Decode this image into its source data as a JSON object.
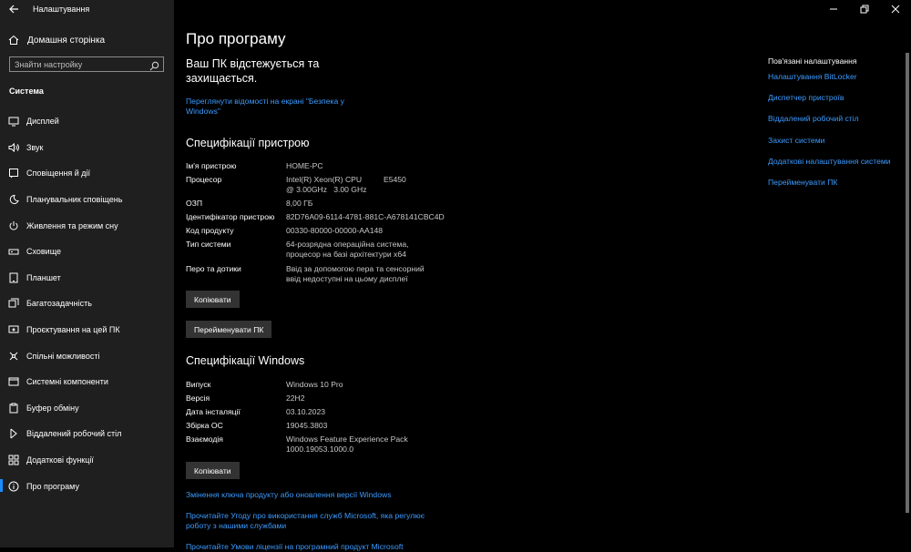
{
  "window": {
    "title": "Налаштування",
    "controls": [
      "minimize",
      "restore",
      "close"
    ]
  },
  "sidebar": {
    "home_label": "Домашня сторінка",
    "search_placeholder": "Знайти настройку",
    "section_title": "Система",
    "items": [
      {
        "label": "Дисплей",
        "icon": "display-icon"
      },
      {
        "label": "Звук",
        "icon": "sound-icon"
      },
      {
        "label": "Сповіщення й дії",
        "icon": "notifications-icon"
      },
      {
        "label": "Планувальник сповіщень",
        "icon": "focus-assist-icon"
      },
      {
        "label": "Живлення та режим сну",
        "icon": "power-icon"
      },
      {
        "label": "Сховище",
        "icon": "storage-icon"
      },
      {
        "label": "Планшет",
        "icon": "tablet-icon"
      },
      {
        "label": "Багатозадачність",
        "icon": "multitasking-icon"
      },
      {
        "label": "Проєктування на цей ПК",
        "icon": "projecting-icon"
      },
      {
        "label": "Спільні можливості",
        "icon": "shared-experiences-icon"
      },
      {
        "label": "Системні компоненти",
        "icon": "system-components-icon"
      },
      {
        "label": "Буфер обміну",
        "icon": "clipboard-icon"
      },
      {
        "label": "Віддалений робочий стіл",
        "icon": "remote-desktop-icon"
      },
      {
        "label": "Додаткові функції",
        "icon": "optional-features-icon"
      },
      {
        "label": "Про програму",
        "icon": "about-icon",
        "selected": true
      }
    ]
  },
  "main": {
    "title": "Про програму",
    "protection_text": "Ваш ПК відстежується та захищається.",
    "security_link": "Переглянути відомості на екрані \"Безпека у Windows\"",
    "device_specs": {
      "heading": "Специфікації пристрою",
      "rows": [
        {
          "key": "Ім'я пристрою",
          "value": "HOME-PC"
        },
        {
          "key": "Процесор",
          "value": "Intel(R) Xeon(R) CPU          E5450  @ 3.00GHz   3.00 GHz"
        },
        {
          "key": "ОЗП",
          "value": "8,00 ГБ"
        },
        {
          "key": "Ідентифікатор пристрою",
          "value": "82D76A09-6114-4781-881C-A678141CBC4D"
        },
        {
          "key": "Код продукту",
          "value": "00330-80000-00000-AA148"
        },
        {
          "key": "Тип системи",
          "value": "64-розрядна операційна система, процесор на базі архітектури x64"
        },
        {
          "key": "Перо та дотики",
          "value": "Ввід за допомогою пера та сенсорний ввід недоступні на цьому дисплеї"
        }
      ],
      "copy_button": "Копіювати",
      "rename_button": "Перейменувати ПК"
    },
    "windows_specs": {
      "heading": "Специфікації Windows",
      "rows": [
        {
          "key": "Випуск",
          "value": "Windows 10 Pro"
        },
        {
          "key": "Версія",
          "value": "22H2"
        },
        {
          "key": "Дата інсталяції",
          "value": "03.10.2023"
        },
        {
          "key": "Збірка ОС",
          "value": "19045.3803"
        },
        {
          "key": "Взаємодія",
          "value": "Windows Feature Experience Pack 1000.19053.1000.0"
        }
      ],
      "copy_button": "Копіювати"
    },
    "bottom_links": [
      "Змінення ключа продукту або оновлення версії Windows",
      "Прочитайте Угоду про використання служб Microsoft, яка регулює роботу з нашими службами",
      "Прочитайте Умови ліцензії на програмний продукт Microsoft"
    ]
  },
  "related": {
    "title": "Пов'язані налаштування",
    "links": [
      "Налаштування BitLocker",
      "Диспетчер пристроїв",
      "Віддалений робочий стіл",
      "Захист системи",
      "Додаткові налаштування системи",
      "Перейменувати ПК"
    ]
  }
}
